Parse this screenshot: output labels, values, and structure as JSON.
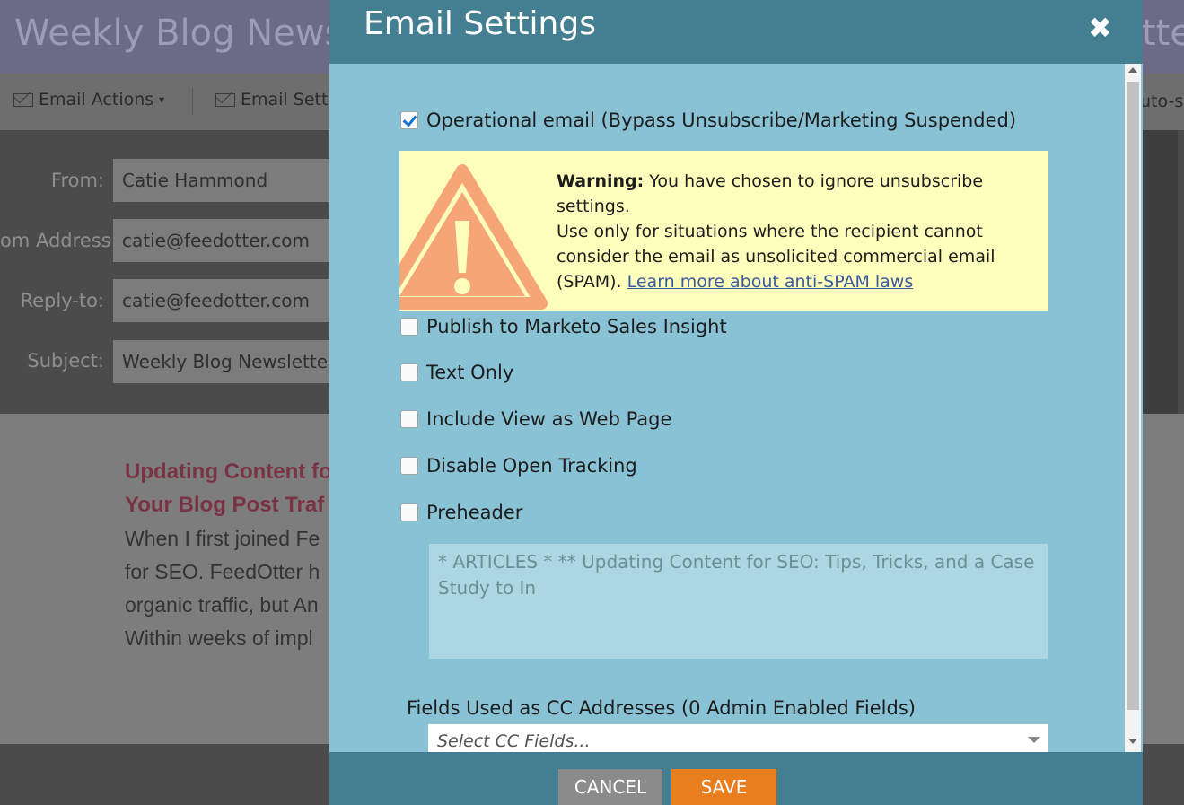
{
  "background": {
    "title": "Weekly Blog Newsl",
    "title_right": "tte",
    "toolbar": {
      "email_actions": "Email Actions",
      "email_settings": "Email Setti",
      "right_fragment": "uto-s"
    },
    "form": {
      "from_label": "From:",
      "from_value": "Catie Hammond",
      "address_label": "om Address:",
      "address_value": "catie@feedotter.com",
      "replyto_label": "Reply-to:",
      "replyto_value": "catie@feedotter.com",
      "subject_label": "Subject:",
      "subject_value": "Weekly Blog Newslette"
    },
    "content": {
      "heading_line1": "Updating Content fo",
      "heading_line2": "Your Blog Post Traf",
      "para_line1": "When I first joined Fe",
      "para_line2": "for SEO. FeedOtter h",
      "para_line3": "organic traffic, but An",
      "para_line4": "Within weeks of impl"
    }
  },
  "modal": {
    "title": "Email Settings",
    "close_glyph": "✖",
    "options": {
      "operational": "Operational email (Bypass Unsubscribe/Marketing Suspended)",
      "publish": "Publish to Marketo Sales Insight",
      "text_only": "Text Only",
      "view_web": "Include View as Web Page",
      "disable_open": "Disable Open Tracking",
      "preheader": "Preheader"
    },
    "checked": {
      "operational": true,
      "publish": false,
      "text_only": false,
      "view_web": false,
      "disable_open": false,
      "preheader": false
    },
    "warning": {
      "label": "Warning:",
      "line1": " You have chosen to ignore unsubscribe settings.",
      "line2": "Use only for situations where the recipient cannot consider the email as unsolicited commercial email (SPAM). ",
      "link": "Learn more about anti-SPAM laws"
    },
    "preheader_text": "* ARTICLES *   ** Updating Content for SEO: Tips, Tricks, and a Case Study to In",
    "cc_label": "Fields Used as CC Addresses (0 Admin Enabled Fields)",
    "cc_placeholder": "Select CC Fields...",
    "cancel": "CANCEL",
    "save": "SAVE"
  },
  "colors": {
    "modal_bg": "#88c2d4",
    "modal_header": "#447f91",
    "warning_bg": "#fefebc",
    "warning_icon": "#f6a676",
    "save": "#e97e1f",
    "cancel": "#8b8b8b"
  },
  "icons": {
    "close": "close-icon",
    "warning": "warning-triangle-icon",
    "email": "envelope-icon",
    "dropdown": "chevron-down-icon"
  }
}
